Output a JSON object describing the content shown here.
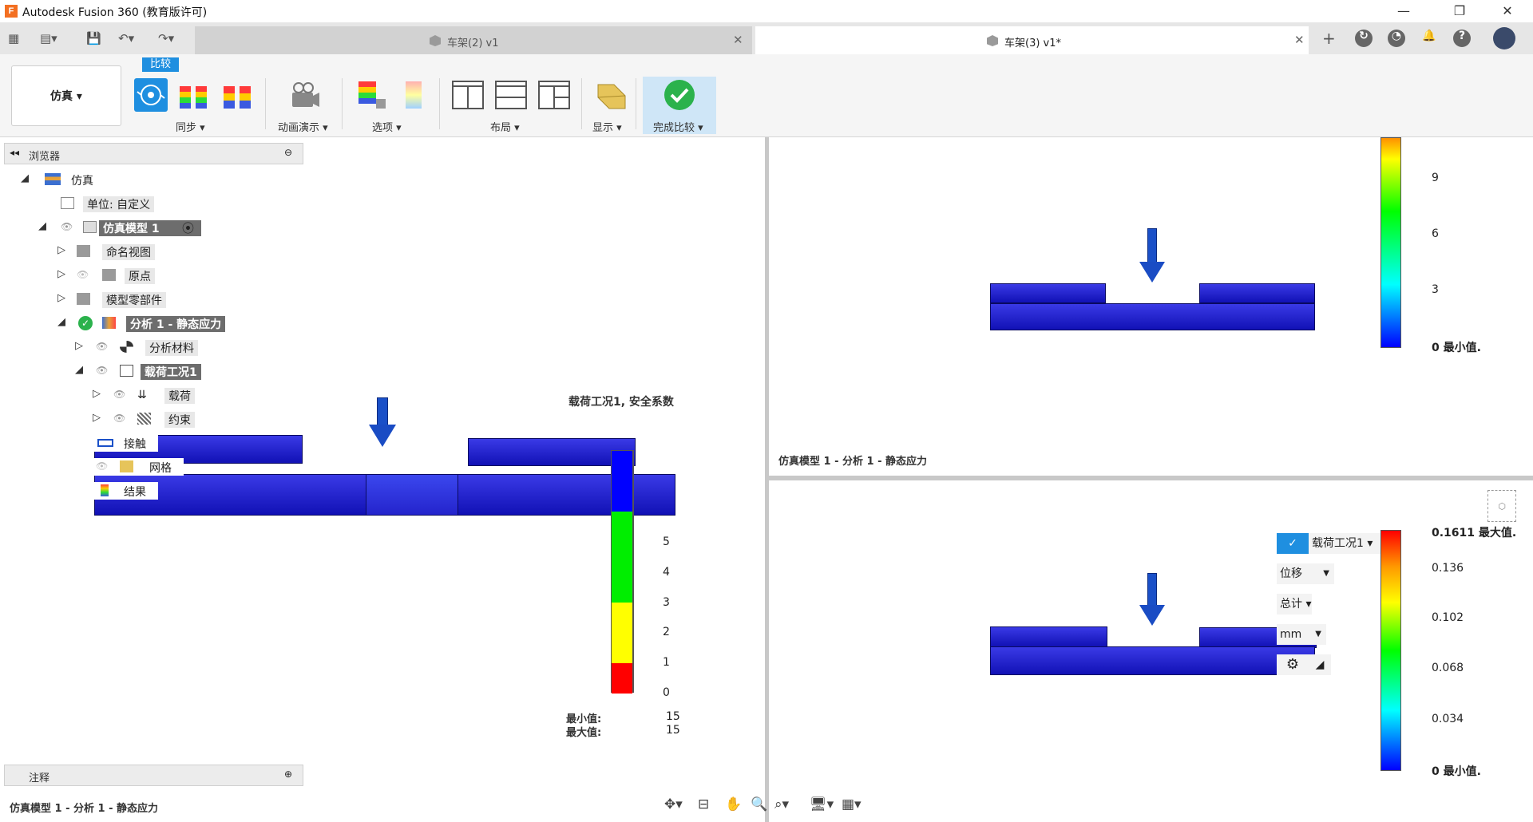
{
  "app": {
    "title": "Autodesk Fusion 360 (教育版许可)",
    "logo": "F"
  },
  "window_controls": {
    "minimize": "—",
    "restore": "❐",
    "close": "✕"
  },
  "tabs": [
    {
      "label": "车架(2) v1",
      "close": "✕"
    },
    {
      "label": "车架(3) v1*",
      "close": "✕"
    }
  ],
  "ribbon": {
    "workspace": "仿真 ▾",
    "compare_label": "比较",
    "groups": {
      "sync": "同步 ▾",
      "animate": "动画演示 ▾",
      "options": "选项 ▾",
      "layout": "布局 ▾",
      "display": "显示 ▾",
      "finish": "完成比较 ▾"
    }
  },
  "browser": {
    "header": "浏览器",
    "items": [
      {
        "label": "仿真"
      },
      {
        "label": "单位: 自定义"
      },
      {
        "label": "仿真模型 1"
      },
      {
        "label": "命名视图"
      },
      {
        "label": "原点"
      },
      {
        "label": "模型零部件"
      },
      {
        "label": "分析 1 - 静态应力"
      },
      {
        "label": "分析材料"
      },
      {
        "label": "载荷工况1"
      },
      {
        "label": "载荷"
      },
      {
        "label": "约束"
      },
      {
        "label": "接触"
      },
      {
        "label": "网格"
      },
      {
        "label": "结果"
      }
    ]
  },
  "annotations": {
    "header": "注释"
  },
  "left_view": {
    "result_title": "载荷工况1, 安全系数",
    "legend_ticks": [
      "5",
      "4",
      "3",
      "2",
      "1",
      "0"
    ],
    "min_label": "最小值:",
    "max_label": "最大值:",
    "min_value": "15",
    "max_value": "15",
    "caption": "仿真模型 1 - 分析 1 - 静态应力"
  },
  "upper_right_view": {
    "legend_ticks": [
      "9",
      "6",
      "3",
      "0 最小值."
    ],
    "caption": "仿真模型 1 - 分析 1 - 静态应力"
  },
  "lower_right_view": {
    "legend_ticks": [
      "0.1611 最大值.",
      "0.136",
      "0.102",
      "0.068",
      "0.034",
      "0 最小值."
    ],
    "loadcase_select": "载荷工况1 ▾",
    "result_type": "位移",
    "component": "总计 ▾",
    "unit": "mm"
  },
  "colors": {
    "accent": "#1f8fe0",
    "model_blue": "#1a1acc",
    "selection_gray": "#6d6d6d",
    "finish_green": "#2bb24c"
  }
}
